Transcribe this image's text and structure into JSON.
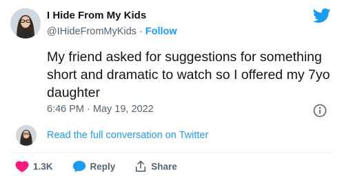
{
  "author": {
    "display_name": "I Hide From My Kids",
    "handle": "@IHideFromMyKids",
    "separator": "·",
    "follow_label": "Follow"
  },
  "tweet": {
    "text": "My friend asked for suggestions for something short and dramatic to watch so I offered my 7yo daughter",
    "timestamp": "6:46 PM · May 19, 2022"
  },
  "conversation": {
    "link_label": "Read the full conversation on Twitter"
  },
  "actions": {
    "like_count": "1.3K",
    "reply_label": "Reply",
    "share_label": "Share"
  },
  "icons": {
    "brand": "twitter-bird-icon",
    "info": "info-icon",
    "like": "heart-icon",
    "reply": "speech-bubble-icon",
    "share": "share-arrow-icon"
  },
  "colors": {
    "text_primary": "#0f1419",
    "text_secondary": "#536471",
    "accent_blue": "#1d9bf0",
    "like_red": "#f91880",
    "divider": "#eff3f4"
  }
}
